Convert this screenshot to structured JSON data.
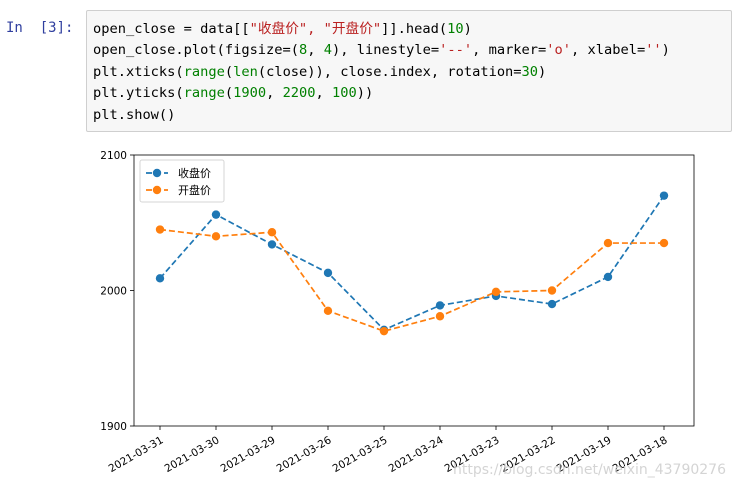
{
  "cell": {
    "prompt": "In  [3]:",
    "code_lines": [
      [
        {
          "t": "open_close = data[["
        },
        {
          "t": "\"收盘价\", \"开盘价\"",
          "c": "s"
        },
        {
          "t": "]].head("
        },
        {
          "t": "10",
          "c": "n"
        },
        {
          "t": ")"
        }
      ],
      [
        {
          "t": "open_close.plot(figsize=("
        },
        {
          "t": "8",
          "c": "n"
        },
        {
          "t": ", "
        },
        {
          "t": "4",
          "c": "n"
        },
        {
          "t": "), linestyle="
        },
        {
          "t": "'--'",
          "c": "s"
        },
        {
          "t": ", marker="
        },
        {
          "t": "'o'",
          "c": "s"
        },
        {
          "t": ", xlabel="
        },
        {
          "t": "''",
          "c": "s"
        },
        {
          "t": ")"
        }
      ],
      [
        {
          "t": "plt.xticks("
        },
        {
          "t": "range",
          "c": "n"
        },
        {
          "t": "("
        },
        {
          "t": "len",
          "c": "n"
        },
        {
          "t": "(close)), close.index, rotation="
        },
        {
          "t": "30",
          "c": "n"
        },
        {
          "t": ")"
        }
      ],
      [
        {
          "t": "plt.yticks("
        },
        {
          "t": "range",
          "c": "n"
        },
        {
          "t": "("
        },
        {
          "t": "1900",
          "c": "n"
        },
        {
          "t": ", "
        },
        {
          "t": "2200",
          "c": "n"
        },
        {
          "t": ", "
        },
        {
          "t": "100",
          "c": "n"
        },
        {
          "t": "))"
        }
      ],
      [
        {
          "t": "plt.show()"
        }
      ]
    ]
  },
  "watermark": "https://blog.csdn.net/weixin_43790276",
  "chart_data": {
    "type": "line",
    "categories": [
      "2021-03-31",
      "2021-03-30",
      "2021-03-29",
      "2021-03-26",
      "2021-03-25",
      "2021-03-24",
      "2021-03-23",
      "2021-03-22",
      "2021-03-19",
      "2021-03-18"
    ],
    "series": [
      {
        "name": "收盘价",
        "color": "#1f77b4",
        "values": [
          2009,
          2056,
          2034,
          2013,
          1971,
          1989,
          1996,
          1990,
          2010,
          2070
        ]
      },
      {
        "name": "开盘价",
        "color": "#ff7f0e",
        "values": [
          2045,
          2040,
          2043,
          1985,
          1970,
          1981,
          1999,
          2000,
          2035,
          2035
        ]
      }
    ],
    "yticks": [
      "1900",
      "2000",
      "2100"
    ],
    "ylim": [
      1900,
      2100
    ],
    "linestyle": "dashed",
    "marker": "circle",
    "xtick_rotation": 30,
    "legend": "upper-left",
    "grid": false
  }
}
